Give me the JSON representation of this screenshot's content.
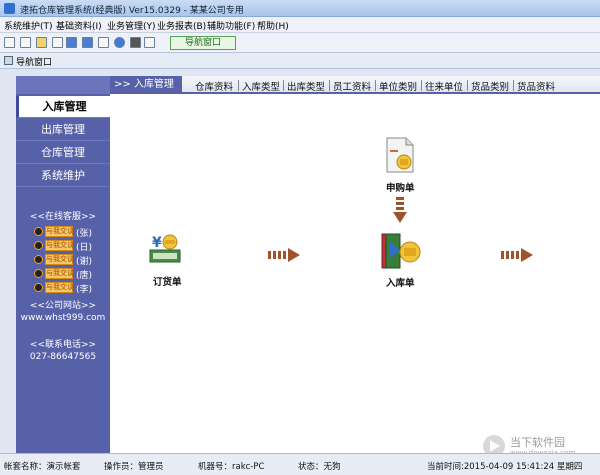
{
  "window": {
    "title": "速拓仓库管理系统(经典版) Ver15.0329 - 某某公司专用"
  },
  "menu": {
    "items": [
      "系统维护(T)",
      "基础资料(I)",
      "业务管理(Y)",
      "业务报表(B)",
      "辅助功能(F)",
      "帮助(H)"
    ]
  },
  "toolbar": {
    "nav_window_button": "导航窗口"
  },
  "subbar": {
    "label": "导航窗口"
  },
  "sidebar": {
    "items": [
      "入库管理",
      "出库管理",
      "仓库管理",
      "系统维护"
    ],
    "service_header": "<<在线客服>>",
    "qq_chat_label": "与我交谈",
    "qq_names": [
      "(张)",
      "(日)",
      "(谢)",
      "(唐)",
      "(李)"
    ],
    "website_header": "<<公司网站>>",
    "website": "www.whst999.com",
    "phone_header": "<<联系电话>>",
    "phone": "027-86647565"
  },
  "main": {
    "tab_title": ">> 入库管理",
    "links": [
      "仓库资料",
      "入库类型",
      "出库类型",
      "员工资料",
      "单位类别",
      "往来单位",
      "货品类别",
      "货品资料"
    ],
    "nodes": {
      "order": "订货单",
      "purchase": "申购单",
      "inbound": "入库单"
    }
  },
  "status": {
    "account": "帐套名称：演示帐套",
    "operator": "操作员：管理员",
    "machine": "机器号：rakc-PC",
    "state": "状态：无狗",
    "time": "当前时间:2015-04-09 15:41:24 星期四"
  },
  "watermark": {
    "text": "当下软件园",
    "url": "www.downxia.com"
  },
  "colors": {
    "sidebar": "#5761a8",
    "arrow": "#a0522d"
  }
}
